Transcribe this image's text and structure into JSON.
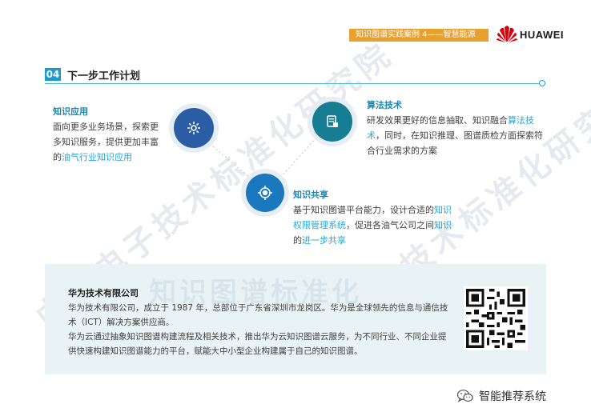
{
  "header": {
    "banner": "知识图谱实践案例 4——智慧能源",
    "brand": "HUAWEI"
  },
  "section": {
    "number": "04",
    "title": "下一步工作计划"
  },
  "watermark": {
    "text": "中国电子技术标准化研究院",
    "box_text": "知识图谱标准化"
  },
  "app_block": {
    "title": "知识应用",
    "body_1": "面向更多业务场景，探索更多知识服务，提供更加丰富的",
    "highlight": "油气行业知识应用"
  },
  "algo_block": {
    "title": "算法技术",
    "body_1": "研发效果更好的信息抽取、知识融合",
    "highlight": "算法技术",
    "body_2": "，同时，在知识推理、图谱质检方面探索符合行业需求的方案"
  },
  "share_block": {
    "title": "知识共享",
    "body_1": "基于知识图谱平台能力，设计合适的",
    "highlight_1": "知识权限管理系统",
    "body_2": "，促进各油气公司之间",
    "highlight_2": "知识",
    "body_3": "的",
    "highlight_3": "进一步共享"
  },
  "company": {
    "title": "华为技术有限公司",
    "p1": "华为技术有限公司，成立于 1987 年，总部位于广东省深圳市龙岗区。华为是全球领先的信息与通信技术（ICT）解决方案供应商。",
    "p2": "华为云通过抽象知识图谱构建流程及相关技术，推出华为云知识图谱云服务，为不同行业、不同企业提供快速构建知识图谱能力的平台，赋能大中小型企业构建属于自己的知识图谱。"
  },
  "footer": {
    "account": "智能推荐系统"
  },
  "colors": {
    "accent_orange": "#e8a12f",
    "accent_blue": "#1a9ad2",
    "highlight_text": "#25a7d8",
    "box_bg": "#e9f3f6"
  },
  "icons": {
    "app": "gear-icon",
    "algo": "document-icon",
    "share": "target-icon",
    "brand": "huawei-petal-icon",
    "footer": "wechat-icon"
  }
}
